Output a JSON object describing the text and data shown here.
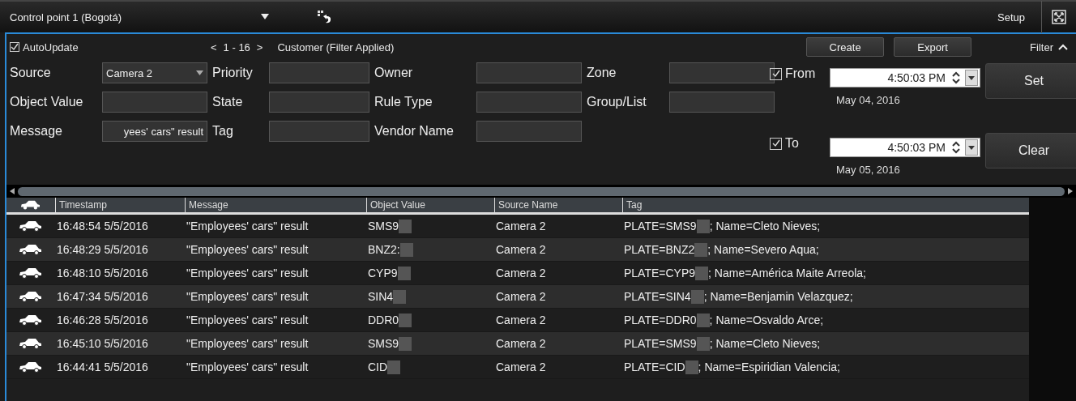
{
  "window": {
    "title": "Control point 1 (Bogotá)",
    "menu": "Setup"
  },
  "toolbar": {
    "autoupdate": {
      "label": "AutoUpdate",
      "checked": true
    },
    "pager": {
      "prev": "<",
      "range": "1 - 16",
      "next": ">"
    },
    "filter_name": "Customer (Filter Applied)",
    "buttons": [
      "Create",
      "Export"
    ],
    "filter_toggle": {
      "label": "Filter",
      "expanded": true
    }
  },
  "fields": [
    {
      "label": "Source",
      "kind": "select",
      "value": "Camera 2"
    },
    {
      "label": "Priority",
      "kind": "text"
    },
    {
      "label": "Owner",
      "kind": "text"
    },
    {
      "label": "Zone",
      "kind": "text"
    },
    {
      "label": "Object Value",
      "kind": "text"
    },
    {
      "label": "State",
      "kind": "text"
    },
    {
      "label": "Rule Type",
      "kind": "text"
    },
    {
      "label": "Group/List",
      "kind": "text"
    },
    {
      "label": "Message",
      "kind": "text",
      "value": "yees' cars\" result"
    },
    {
      "label": "Tag",
      "kind": "text"
    },
    {
      "label": "Vendor Name",
      "kind": "text"
    }
  ],
  "range": [
    {
      "label": "From",
      "checked": true,
      "time": "4:50:03 PM",
      "date": "May 04, 2016",
      "action": "Set"
    },
    {
      "label": "To",
      "checked": true,
      "time": "4:50:03 PM",
      "date": "May 05, 2016",
      "action": "Clear"
    }
  ],
  "table": {
    "columns": [
      "Timestamp",
      "Message",
      "Object Value",
      "Source Name",
      "Tag"
    ],
    "rows": [
      {
        "timestamp": "16:48:54 5/5/2016",
        "message": "\"Employees' cars\" result",
        "object_value": "SMS9",
        "source": "Camera 2",
        "tag_plate": "PLATE=SMS9",
        "tag_rest": "; Name=Cleto Nieves;"
      },
      {
        "timestamp": "16:48:29 5/5/2016",
        "message": "\"Employees' cars\" result",
        "object_value": "BNZ2:",
        "source": "Camera 2",
        "tag_plate": "PLATE=BNZ2",
        "tag_rest": "; Name=Severo Aqua;"
      },
      {
        "timestamp": "16:48:10 5/5/2016",
        "message": "\"Employees' cars\" result",
        "object_value": "CYP9",
        "source": "Camera 2",
        "tag_plate": "PLATE=CYP9",
        "tag_rest": "; Name=América Maite Arreola;"
      },
      {
        "timestamp": "16:47:34 5/5/2016",
        "message": "\"Employees' cars\" result",
        "object_value": "SIN4",
        "source": "Camera 2",
        "tag_plate": "PLATE=SIN4",
        "tag_rest": "; Name=Benjamin Velazquez;"
      },
      {
        "timestamp": "16:46:28 5/5/2016",
        "message": "\"Employees' cars\" result",
        "object_value": "DDR0",
        "source": "Camera 2",
        "tag_plate": "PLATE=DDR0",
        "tag_rest": "; Name=Osvaldo Arce;"
      },
      {
        "timestamp": "16:45:10 5/5/2016",
        "message": "\"Employees' cars\" result",
        "object_value": "SMS9",
        "source": "Camera 2",
        "tag_plate": "PLATE=SMS9",
        "tag_rest": "; Name=Cleto Nieves;"
      },
      {
        "timestamp": "16:44:41 5/5/2016",
        "message": "\"Employees' cars\" result",
        "object_value": "CID",
        "source": "Camera 2",
        "tag_plate": "PLATE=CID",
        "tag_rest": "; Name=Espiridian Valencia;"
      }
    ]
  }
}
